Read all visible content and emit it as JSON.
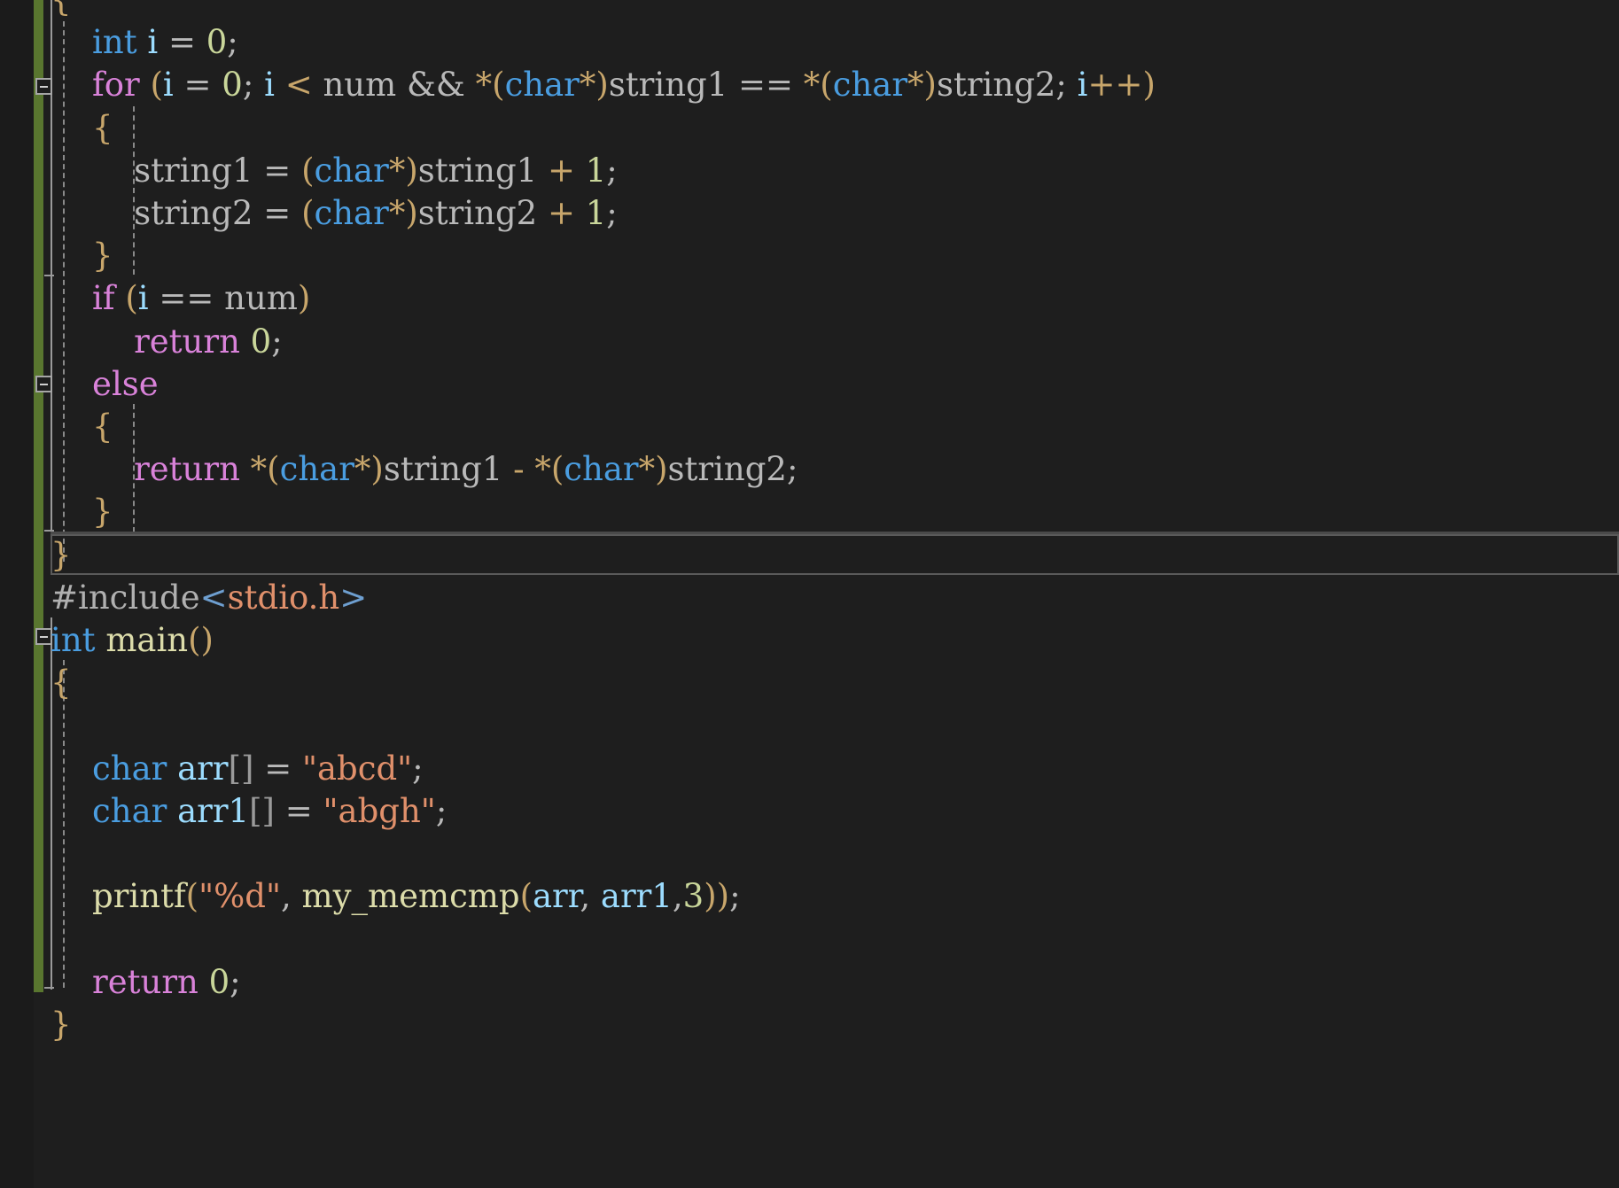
{
  "editor": {
    "app": "code-editor",
    "language": "c",
    "background": "#1e1e1e",
    "gutter_background": "#1b1b1b",
    "change_bar_color": "#59762f",
    "current_line_border": "#5a5a5a",
    "fold_marker_glyph": "−"
  },
  "colors": {
    "keyword": "#d982d9",
    "type": "#4a9de0",
    "identifier": "#b9b9b9",
    "variable": "#9cdcfe",
    "function": "#dcdcaa",
    "number": "#c9d69a",
    "string": "#e0906b",
    "punctuation": "#c8a66b",
    "operator": "#b9b9b9",
    "bracket": "#9a9a9a",
    "preprocessor": "#b0b0b0",
    "angle_bracket": "#6e9fd0"
  },
  "code_lines": [
    {
      "id": "line-open-brace",
      "indent": 0,
      "text": "{",
      "tokens": [
        {
          "t": "{",
          "c": "brace"
        }
      ]
    },
    {
      "id": "line-int-i",
      "indent": 0,
      "text": "    int i = 0;",
      "tokens": [
        {
          "t": "    ",
          "c": "op"
        },
        {
          "t": "int",
          "c": "type"
        },
        {
          "t": " ",
          "c": "op"
        },
        {
          "t": "i",
          "c": "var"
        },
        {
          "t": " = ",
          "c": "op"
        },
        {
          "t": "0",
          "c": "num"
        },
        {
          "t": ";",
          "c": "op"
        }
      ]
    },
    {
      "id": "line-for",
      "indent": 0,
      "text": "    for (i = 0; i < num && *(char*)string1 == *(char*)string2; i++)",
      "tokens": [
        {
          "t": "    ",
          "c": "op"
        },
        {
          "t": "for",
          "c": "kw"
        },
        {
          "t": " ",
          "c": "op"
        },
        {
          "t": "(",
          "c": "punc"
        },
        {
          "t": "i",
          "c": "var"
        },
        {
          "t": " = ",
          "c": "op"
        },
        {
          "t": "0",
          "c": "num"
        },
        {
          "t": "; ",
          "c": "op"
        },
        {
          "t": "i",
          "c": "var"
        },
        {
          "t": " ",
          "c": "op"
        },
        {
          "t": "<",
          "c": "punc"
        },
        {
          "t": " ",
          "c": "op"
        },
        {
          "t": "num",
          "c": "ident"
        },
        {
          "t": " ",
          "c": "op"
        },
        {
          "t": "&&",
          "c": "op"
        },
        {
          "t": " ",
          "c": "op"
        },
        {
          "t": "*(",
          "c": "punc"
        },
        {
          "t": "char",
          "c": "type"
        },
        {
          "t": "*)",
          "c": "punc"
        },
        {
          "t": "string1",
          "c": "ident"
        },
        {
          "t": " ",
          "c": "op"
        },
        {
          "t": "==",
          "c": "op"
        },
        {
          "t": " ",
          "c": "op"
        },
        {
          "t": "*(",
          "c": "punc"
        },
        {
          "t": "char",
          "c": "type"
        },
        {
          "t": "*)",
          "c": "punc"
        },
        {
          "t": "string2",
          "c": "ident"
        },
        {
          "t": "; ",
          "c": "op"
        },
        {
          "t": "i",
          "c": "var"
        },
        {
          "t": "++)",
          "c": "punc"
        }
      ]
    },
    {
      "id": "line-for-open",
      "indent": 0,
      "text": "    {",
      "tokens": [
        {
          "t": "    ",
          "c": "op"
        },
        {
          "t": "{",
          "c": "brace"
        }
      ]
    },
    {
      "id": "line-string1-inc",
      "indent": 0,
      "text": "        string1 = (char*)string1 + 1;",
      "tokens": [
        {
          "t": "        ",
          "c": "op"
        },
        {
          "t": "string1",
          "c": "ident"
        },
        {
          "t": " = ",
          "c": "op"
        },
        {
          "t": "(",
          "c": "punc"
        },
        {
          "t": "char",
          "c": "type"
        },
        {
          "t": "*)",
          "c": "punc"
        },
        {
          "t": "string1",
          "c": "ident"
        },
        {
          "t": " ",
          "c": "op"
        },
        {
          "t": "+",
          "c": "punc"
        },
        {
          "t": " ",
          "c": "op"
        },
        {
          "t": "1",
          "c": "num"
        },
        {
          "t": ";",
          "c": "op"
        }
      ]
    },
    {
      "id": "line-string2-inc",
      "indent": 0,
      "text": "        string2 = (char*)string2 + 1;",
      "tokens": [
        {
          "t": "        ",
          "c": "op"
        },
        {
          "t": "string2",
          "c": "ident"
        },
        {
          "t": " = ",
          "c": "op"
        },
        {
          "t": "(",
          "c": "punc"
        },
        {
          "t": "char",
          "c": "type"
        },
        {
          "t": "*)",
          "c": "punc"
        },
        {
          "t": "string2",
          "c": "ident"
        },
        {
          "t": " ",
          "c": "op"
        },
        {
          "t": "+",
          "c": "punc"
        },
        {
          "t": " ",
          "c": "op"
        },
        {
          "t": "1",
          "c": "num"
        },
        {
          "t": ";",
          "c": "op"
        }
      ]
    },
    {
      "id": "line-for-close",
      "indent": 0,
      "text": "    }",
      "tokens": [
        {
          "t": "    ",
          "c": "op"
        },
        {
          "t": "}",
          "c": "brace"
        }
      ]
    },
    {
      "id": "line-if",
      "indent": 0,
      "text": "    if (i == num)",
      "tokens": [
        {
          "t": "    ",
          "c": "op"
        },
        {
          "t": "if",
          "c": "kw"
        },
        {
          "t": " ",
          "c": "op"
        },
        {
          "t": "(",
          "c": "punc"
        },
        {
          "t": "i",
          "c": "var"
        },
        {
          "t": " ",
          "c": "op"
        },
        {
          "t": "==",
          "c": "op"
        },
        {
          "t": " ",
          "c": "op"
        },
        {
          "t": "num",
          "c": "ident"
        },
        {
          "t": ")",
          "c": "punc"
        }
      ]
    },
    {
      "id": "line-return-0",
      "indent": 0,
      "text": "        return 0;",
      "tokens": [
        {
          "t": "        ",
          "c": "op"
        },
        {
          "t": "return",
          "c": "kw"
        },
        {
          "t": " ",
          "c": "op"
        },
        {
          "t": "0",
          "c": "num"
        },
        {
          "t": ";",
          "c": "op"
        }
      ]
    },
    {
      "id": "line-else",
      "indent": 0,
      "text": "    else",
      "tokens": [
        {
          "t": "    ",
          "c": "op"
        },
        {
          "t": "else",
          "c": "kw"
        }
      ]
    },
    {
      "id": "line-else-open",
      "indent": 0,
      "text": "    {",
      "tokens": [
        {
          "t": "    ",
          "c": "op"
        },
        {
          "t": "{",
          "c": "brace"
        }
      ]
    },
    {
      "id": "line-return-diff",
      "indent": 0,
      "text": "        return *(char*)string1 - *(char*)string2;",
      "tokens": [
        {
          "t": "        ",
          "c": "op"
        },
        {
          "t": "return",
          "c": "kw"
        },
        {
          "t": " ",
          "c": "op"
        },
        {
          "t": "*(",
          "c": "punc"
        },
        {
          "t": "char",
          "c": "type"
        },
        {
          "t": "*)",
          "c": "punc"
        },
        {
          "t": "string1",
          "c": "ident"
        },
        {
          "t": " ",
          "c": "op"
        },
        {
          "t": "-",
          "c": "punc"
        },
        {
          "t": " ",
          "c": "op"
        },
        {
          "t": "*(",
          "c": "punc"
        },
        {
          "t": "char",
          "c": "type"
        },
        {
          "t": "*)",
          "c": "punc"
        },
        {
          "t": "string2",
          "c": "ident"
        },
        {
          "t": ";",
          "c": "op"
        }
      ]
    },
    {
      "id": "line-else-close",
      "indent": 0,
      "text": "    }",
      "tokens": [
        {
          "t": "    ",
          "c": "op"
        },
        {
          "t": "}",
          "c": "brace"
        }
      ]
    },
    {
      "id": "line-func-close",
      "indent": 0,
      "text": "}",
      "tokens": [
        {
          "t": "}",
          "c": "brace"
        }
      ],
      "current": true
    },
    {
      "id": "line-include",
      "indent": 0,
      "text": "#include<stdio.h>",
      "tokens": [
        {
          "t": "#include",
          "c": "pre"
        },
        {
          "t": "<",
          "c": "angle"
        },
        {
          "t": "stdio.h",
          "c": "str"
        },
        {
          "t": ">",
          "c": "angle"
        }
      ]
    },
    {
      "id": "line-main",
      "indent": 0,
      "text": "int main()",
      "tokens": [
        {
          "t": "int",
          "c": "type"
        },
        {
          "t": " ",
          "c": "op"
        },
        {
          "t": "main",
          "c": "func"
        },
        {
          "t": "()",
          "c": "punc"
        }
      ]
    },
    {
      "id": "line-main-open",
      "indent": 0,
      "text": "{",
      "tokens": [
        {
          "t": "{",
          "c": "brace"
        }
      ]
    },
    {
      "id": "line-blank-1",
      "indent": 0,
      "text": "",
      "tokens": []
    },
    {
      "id": "line-char-arr",
      "indent": 0,
      "text": "    char arr[] = \"abcd\";",
      "tokens": [
        {
          "t": "    ",
          "c": "op"
        },
        {
          "t": "char",
          "c": "type"
        },
        {
          "t": " ",
          "c": "op"
        },
        {
          "t": "arr",
          "c": "var"
        },
        {
          "t": "[]",
          "c": "brack"
        },
        {
          "t": " = ",
          "c": "op"
        },
        {
          "t": "\"abcd\"",
          "c": "str"
        },
        {
          "t": ";",
          "c": "op"
        }
      ]
    },
    {
      "id": "line-char-arr1",
      "indent": 0,
      "text": "    char arr1[] = \"abgh\";",
      "tokens": [
        {
          "t": "    ",
          "c": "op"
        },
        {
          "t": "char",
          "c": "type"
        },
        {
          "t": " ",
          "c": "op"
        },
        {
          "t": "arr1",
          "c": "var"
        },
        {
          "t": "[]",
          "c": "brack"
        },
        {
          "t": " = ",
          "c": "op"
        },
        {
          "t": "\"abgh\"",
          "c": "str"
        },
        {
          "t": ";",
          "c": "op"
        }
      ]
    },
    {
      "id": "line-blank-2",
      "indent": 0,
      "text": "",
      "tokens": []
    },
    {
      "id": "line-printf",
      "indent": 0,
      "text": "    printf(\"%d\", my_memcmp(arr, arr1,3));",
      "tokens": [
        {
          "t": "    ",
          "c": "op"
        },
        {
          "t": "printf",
          "c": "func"
        },
        {
          "t": "(",
          "c": "punc"
        },
        {
          "t": "\"%d\"",
          "c": "str"
        },
        {
          "t": ", ",
          "c": "op"
        },
        {
          "t": "my_memcmp",
          "c": "func"
        },
        {
          "t": "(",
          "c": "punc"
        },
        {
          "t": "arr",
          "c": "var"
        },
        {
          "t": ", ",
          "c": "op"
        },
        {
          "t": "arr1",
          "c": "var"
        },
        {
          "t": ",",
          "c": "op"
        },
        {
          "t": "3",
          "c": "num"
        },
        {
          "t": "))",
          "c": "punc"
        },
        {
          "t": ";",
          "c": "op"
        }
      ]
    },
    {
      "id": "line-blank-3",
      "indent": 0,
      "text": "",
      "tokens": []
    },
    {
      "id": "line-main-return",
      "indent": 0,
      "text": "    return 0;",
      "tokens": [
        {
          "t": "    ",
          "c": "op"
        },
        {
          "t": "return",
          "c": "kw"
        },
        {
          "t": " ",
          "c": "op"
        },
        {
          "t": "0",
          "c": "num"
        },
        {
          "t": ";",
          "c": "op"
        }
      ]
    },
    {
      "id": "line-main-close",
      "indent": 0,
      "text": "}",
      "tokens": [
        {
          "t": "}",
          "c": "brace"
        }
      ]
    }
  ],
  "fold_markers": [
    {
      "name": "fold-marker-for",
      "state": "expanded"
    },
    {
      "name": "fold-marker-else",
      "state": "expanded"
    },
    {
      "name": "fold-marker-main",
      "state": "expanded"
    }
  ]
}
